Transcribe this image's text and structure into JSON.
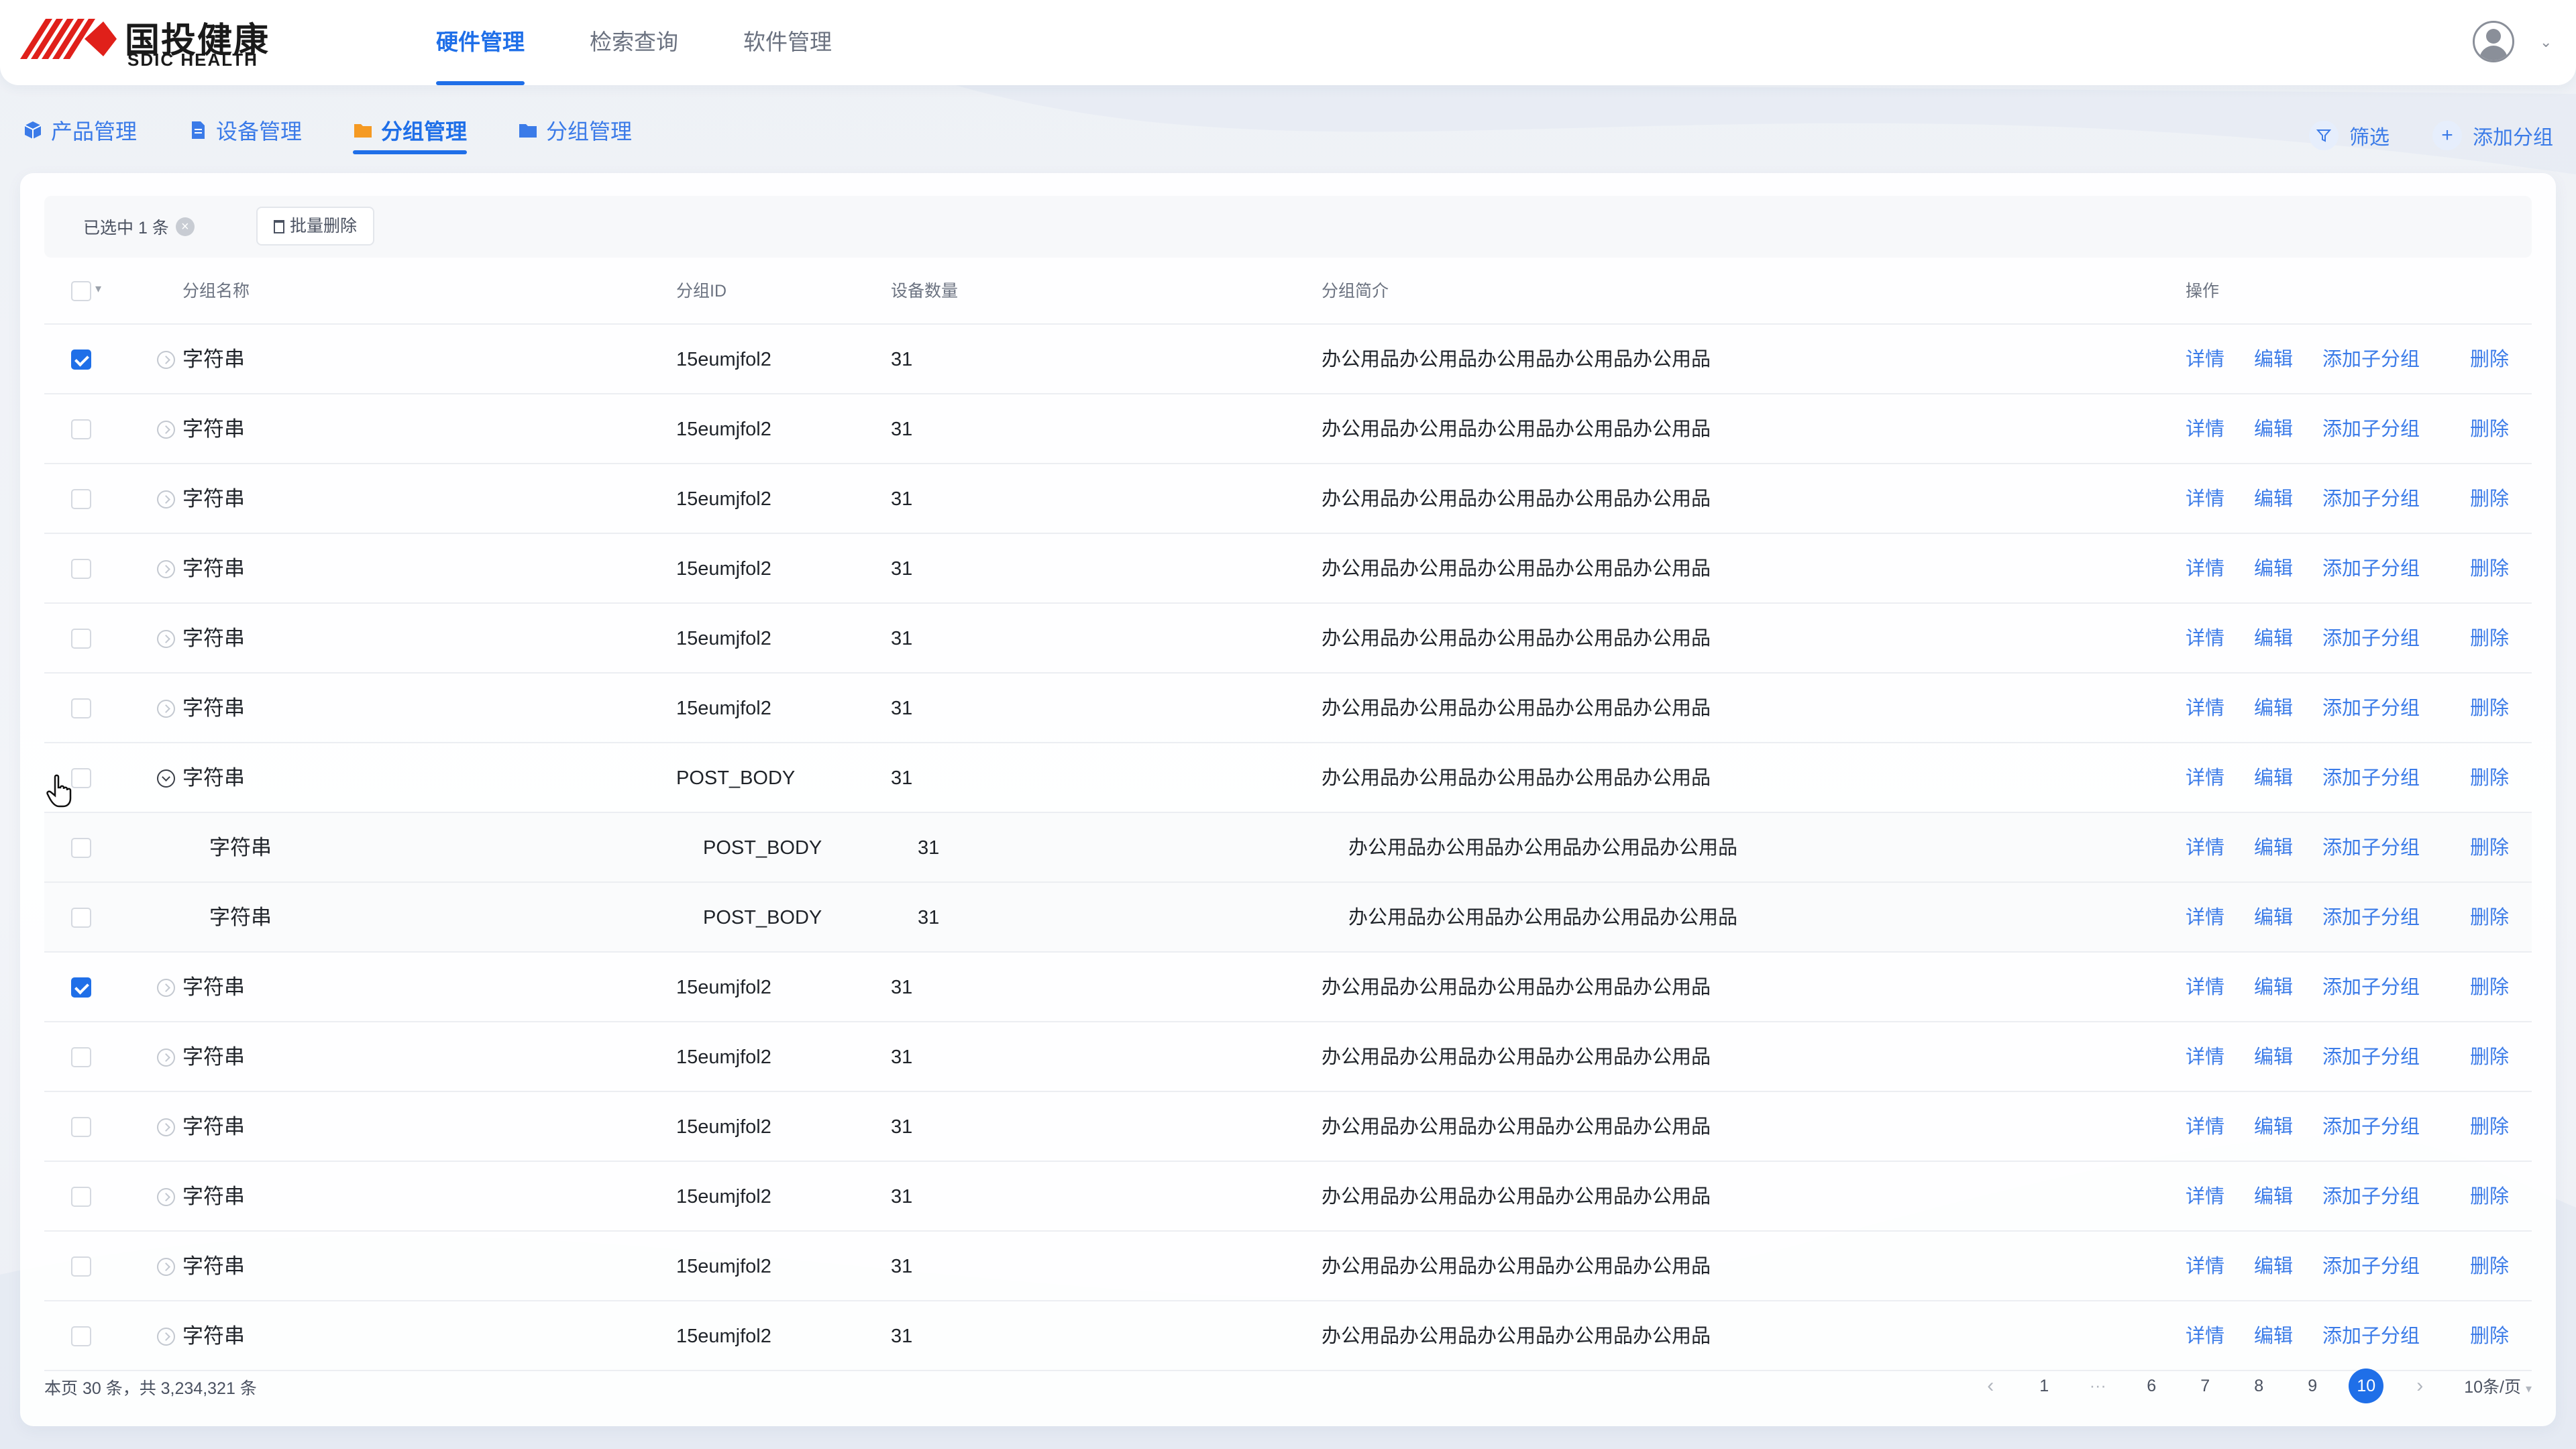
{
  "brand": {
    "name_cn": "国投健康",
    "name_en": "SDIC HEALTH"
  },
  "nav": {
    "items": [
      {
        "label": "硬件管理",
        "active": true
      },
      {
        "label": "检索查询",
        "active": false
      },
      {
        "label": "软件管理",
        "active": false
      }
    ]
  },
  "subtabs": [
    {
      "label": "产品管理",
      "icon": "cube-icon",
      "active": false
    },
    {
      "label": "设备管理",
      "icon": "document-icon",
      "active": false
    },
    {
      "label": "分组管理",
      "icon": "folder-orange-icon",
      "active": true
    },
    {
      "label": "分组管理",
      "icon": "folder-blue-icon",
      "active": false
    }
  ],
  "actions": {
    "filter_label": "筛选",
    "add_group_label": "添加分组"
  },
  "bulk": {
    "selected_text": "已选中 1 条",
    "delete_label": "批量删除"
  },
  "table": {
    "columns": {
      "name": "分组名称",
      "id": "分组ID",
      "count": "设备数量",
      "desc": "分组简介",
      "ops": "操作"
    },
    "op_labels": {
      "detail": "详情",
      "edit": "编辑",
      "add_child": "添加子分组",
      "delete": "删除"
    },
    "rows": [
      {
        "name": "字符串",
        "id": "15eumjfol2",
        "count": "31",
        "desc": "办公用品办公用品办公用品办公用品办公用品",
        "checked": true,
        "level": 0,
        "expanded": false
      },
      {
        "name": "字符串",
        "id": "15eumjfol2",
        "count": "31",
        "desc": "办公用品办公用品办公用品办公用品办公用品",
        "checked": false,
        "level": 0,
        "expanded": false
      },
      {
        "name": "字符串",
        "id": "15eumjfol2",
        "count": "31",
        "desc": "办公用品办公用品办公用品办公用品办公用品",
        "checked": false,
        "level": 0,
        "expanded": false
      },
      {
        "name": "字符串",
        "id": "15eumjfol2",
        "count": "31",
        "desc": "办公用品办公用品办公用品办公用品办公用品",
        "checked": false,
        "level": 0,
        "expanded": false
      },
      {
        "name": "字符串",
        "id": "15eumjfol2",
        "count": "31",
        "desc": "办公用品办公用品办公用品办公用品办公用品",
        "checked": false,
        "level": 0,
        "expanded": false
      },
      {
        "name": "字符串",
        "id": "15eumjfol2",
        "count": "31",
        "desc": "办公用品办公用品办公用品办公用品办公用品",
        "checked": false,
        "level": 0,
        "expanded": false
      },
      {
        "name": "字符串",
        "id": "POST_BODY",
        "count": "31",
        "desc": "办公用品办公用品办公用品办公用品办公用品",
        "checked": false,
        "level": 0,
        "expanded": true
      },
      {
        "name": "字符串",
        "id": "POST_BODY",
        "count": "31",
        "desc": "办公用品办公用品办公用品办公用品办公用品",
        "checked": false,
        "level": 1,
        "expanded": false
      },
      {
        "name": "字符串",
        "id": "POST_BODY",
        "count": "31",
        "desc": "办公用品办公用品办公用品办公用品办公用品",
        "checked": false,
        "level": 1,
        "expanded": false
      },
      {
        "name": "字符串",
        "id": "15eumjfol2",
        "count": "31",
        "desc": "办公用品办公用品办公用品办公用品办公用品",
        "checked": true,
        "level": 0,
        "expanded": false
      },
      {
        "name": "字符串",
        "id": "15eumjfol2",
        "count": "31",
        "desc": "办公用品办公用品办公用品办公用品办公用品",
        "checked": false,
        "level": 0,
        "expanded": false
      },
      {
        "name": "字符串",
        "id": "15eumjfol2",
        "count": "31",
        "desc": "办公用品办公用品办公用品办公用品办公用品",
        "checked": false,
        "level": 0,
        "expanded": false
      },
      {
        "name": "字符串",
        "id": "15eumjfol2",
        "count": "31",
        "desc": "办公用品办公用品办公用品办公用品办公用品",
        "checked": false,
        "level": 0,
        "expanded": false
      },
      {
        "name": "字符串",
        "id": "15eumjfol2",
        "count": "31",
        "desc": "办公用品办公用品办公用品办公用品办公用品",
        "checked": false,
        "level": 0,
        "expanded": false
      },
      {
        "name": "字符串",
        "id": "15eumjfol2",
        "count": "31",
        "desc": "办公用品办公用品办公用品办公用品办公用品",
        "checked": false,
        "level": 0,
        "expanded": false
      }
    ]
  },
  "footer": {
    "summary": "本页 30 条，共 3,234,321 条",
    "pages": [
      "1",
      "···",
      "6",
      "7",
      "8",
      "9",
      "10"
    ],
    "current_page": "10",
    "page_size": "10条/页"
  },
  "colors": {
    "primary": "#1f6fe8",
    "link": "#3b7be8",
    "brand_red": "#e0201a"
  }
}
